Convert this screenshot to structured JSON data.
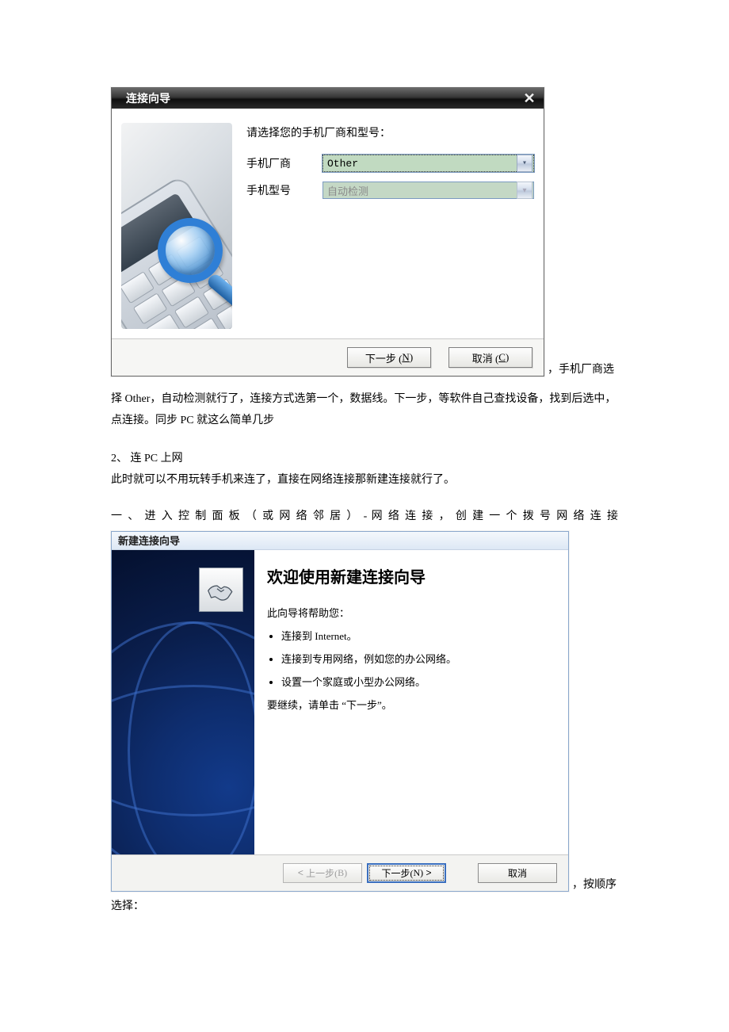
{
  "dlg1": {
    "title": "连接向导",
    "prompt": "请选择您的手机厂商和型号：",
    "row_vendor_label": "手机厂商",
    "row_vendor_value": "Other",
    "row_model_label": "手机型号",
    "row_model_value": "自动检测",
    "next_prefix": "下一步 (",
    "next_key": "N",
    "next_suffix": ")",
    "cancel_prefix": "取消 (",
    "cancel_key": "C",
    "cancel_suffix": ")"
  },
  "caption_right_1": "，手机厂商选",
  "para1": "择 Other，自动检测就行了，连接方式选第一个，数据线。下一步，等软件自己查找设备，找到后选中，点连接。同步 PC 就这么简单几步",
  "heading2": "2、 连 PC 上网",
  "para2": "此时就可以不用玩转手机来连了，直接在网络连接那新建连接就行了。",
  "para3_justify": "一 、 进 入 控 制 面 板 （ 或 网 络 邻 居 ） - 网 络 连 接 ， 创 建 一 个 拨 号 网 络 连 接",
  "dlg2": {
    "title": "新建连接向导",
    "heading": "欢迎使用新建连接向导",
    "intro": "此向导将帮助您：",
    "bullets": [
      "连接到 Internet。",
      "连接到专用网络，例如您的办公网络。",
      "设置一个家庭或小型办公网络。"
    ],
    "continue_text": "要继续，请单击 “下一步”。",
    "back_prefix": "上一步(",
    "back_key": "B",
    "back_suffix": ")",
    "next_prefix": "下一步(",
    "next_key": "N",
    "next_suffix": ")",
    "cancel": "取消"
  },
  "caption_right_2": "，按顺序",
  "para4": "选择："
}
